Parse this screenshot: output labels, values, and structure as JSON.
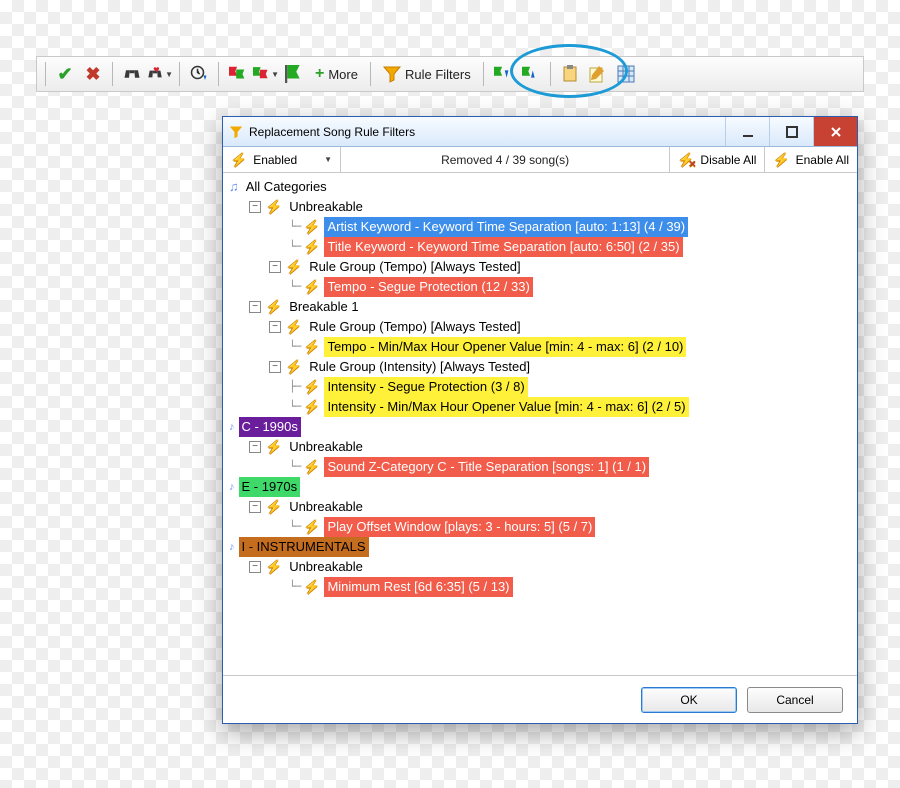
{
  "toolbar": {
    "more_label": "More",
    "rule_filters_label": "Rule Filters"
  },
  "dialog": {
    "title": "Replacement Song Rule Filters",
    "enabled_dropdown": "Enabled",
    "status": "Removed 4 / 39 song(s)",
    "disable_all": "Disable All",
    "enable_all": "Enable All",
    "ok": "OK",
    "cancel": "Cancel"
  },
  "tree": {
    "root": "All Categories",
    "groups": [
      {
        "name": "Unbreakable",
        "rules": [
          {
            "text": "Artist Keyword - Keyword Time Separation [auto: 1:13] (4 / 39)",
            "hl": "hl-blue"
          },
          {
            "text": "Title Keyword - Keyword Time Separation [auto: 6:50] (2 / 35)",
            "hl": "hl-red"
          }
        ],
        "subgroups": [
          {
            "name": "Rule Group (Tempo) [Always Tested]",
            "rules": [
              {
                "text": "Tempo - Segue Protection (12 / 33)",
                "hl": "hl-red"
              }
            ]
          }
        ]
      },
      {
        "name": "Breakable 1",
        "subgroups": [
          {
            "name": "Rule Group (Tempo) [Always Tested]",
            "rules": [
              {
                "text": "Tempo - Min/Max Hour Opener Value [min: 4 - max: 6] (2 / 10)",
                "hl": "hl-yellow"
              }
            ]
          },
          {
            "name": "Rule Group (Intensity) [Always Tested]",
            "rules": [
              {
                "text": "Intensity - Segue Protection (3 / 8)",
                "hl": "hl-yellow"
              },
              {
                "text": "Intensity - Min/Max Hour Opener Value [min: 4 - max: 6] (2 / 5)",
                "hl": "hl-yellow"
              }
            ]
          }
        ]
      }
    ],
    "categories": [
      {
        "label": "C - 1990s",
        "hl": "hl-purple",
        "group": "Unbreakable",
        "rules": [
          {
            "text": "Sound Z-Category C - Title Separation [songs: 1] (1 / 1)",
            "hl": "hl-red"
          }
        ]
      },
      {
        "label": "E - 1970s",
        "hl": "hl-green",
        "group": "Unbreakable",
        "rules": [
          {
            "text": "Play Offset Window [plays: 3 - hours: 5] (5 / 7)",
            "hl": "hl-red"
          }
        ]
      },
      {
        "label": "I - INSTRUMENTALS",
        "hl": "hl-brown",
        "group": "Unbreakable",
        "rules": [
          {
            "text": "Minimum Rest [6d 6:35] (5 / 13)",
            "hl": "hl-red"
          }
        ]
      }
    ]
  }
}
